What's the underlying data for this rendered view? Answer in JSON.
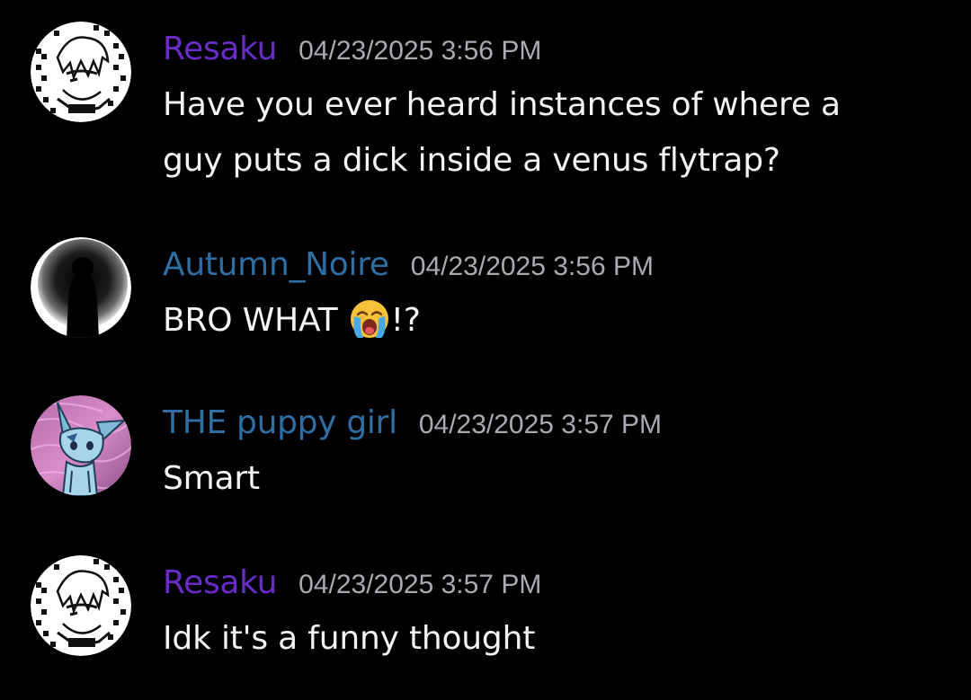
{
  "colors": {
    "background": "#000000",
    "resaku_name": "#6a2cc8",
    "autumn_name": "#2f6ea3",
    "puppy_name": "#2f6ea3",
    "timestamp": "#a9abb2",
    "message_text": "#f2f3f5"
  },
  "messages": [
    {
      "username": "Resaku",
      "timestamp": "04/23/2025 3:56 PM",
      "avatar_icon": "anime-character-avatar",
      "lines": [
        "Have you ever heard instances of where a",
        "guy puts a dick inside a venus flytrap?"
      ]
    },
    {
      "username": "Autumn_Noire",
      "timestamp": "04/23/2025 3:56 PM",
      "avatar_icon": "dark-silhouette-avatar",
      "text_before_emoji": "BRO WHAT ",
      "emoji": "loudly-crying-face-emoji",
      "text_after_emoji": "!?"
    },
    {
      "username": "THE puppy girl",
      "timestamp": "04/23/2025 3:57 PM",
      "avatar_icon": "glaceon-avatar",
      "text": "Smart"
    },
    {
      "username": "Resaku",
      "timestamp": "04/23/2025 3:57 PM",
      "avatar_icon": "anime-character-avatar",
      "text": "Idk it's a funny thought"
    }
  ]
}
